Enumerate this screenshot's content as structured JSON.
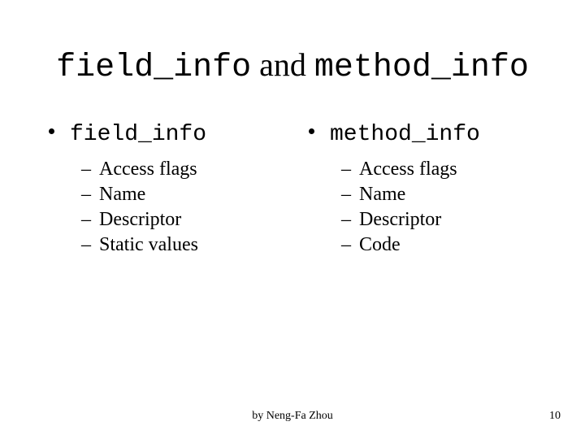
{
  "title": {
    "code1": "field_info",
    "connector": " and ",
    "code2": "method_info"
  },
  "left": {
    "heading": "field_info",
    "items": [
      "Access flags",
      "Name",
      "Descriptor",
      "Static values"
    ]
  },
  "right": {
    "heading": "method_info",
    "items": [
      "Access flags",
      "Name",
      "Descriptor",
      "Code"
    ]
  },
  "footer": {
    "author": "by Neng-Fa Zhou",
    "page": "10"
  }
}
